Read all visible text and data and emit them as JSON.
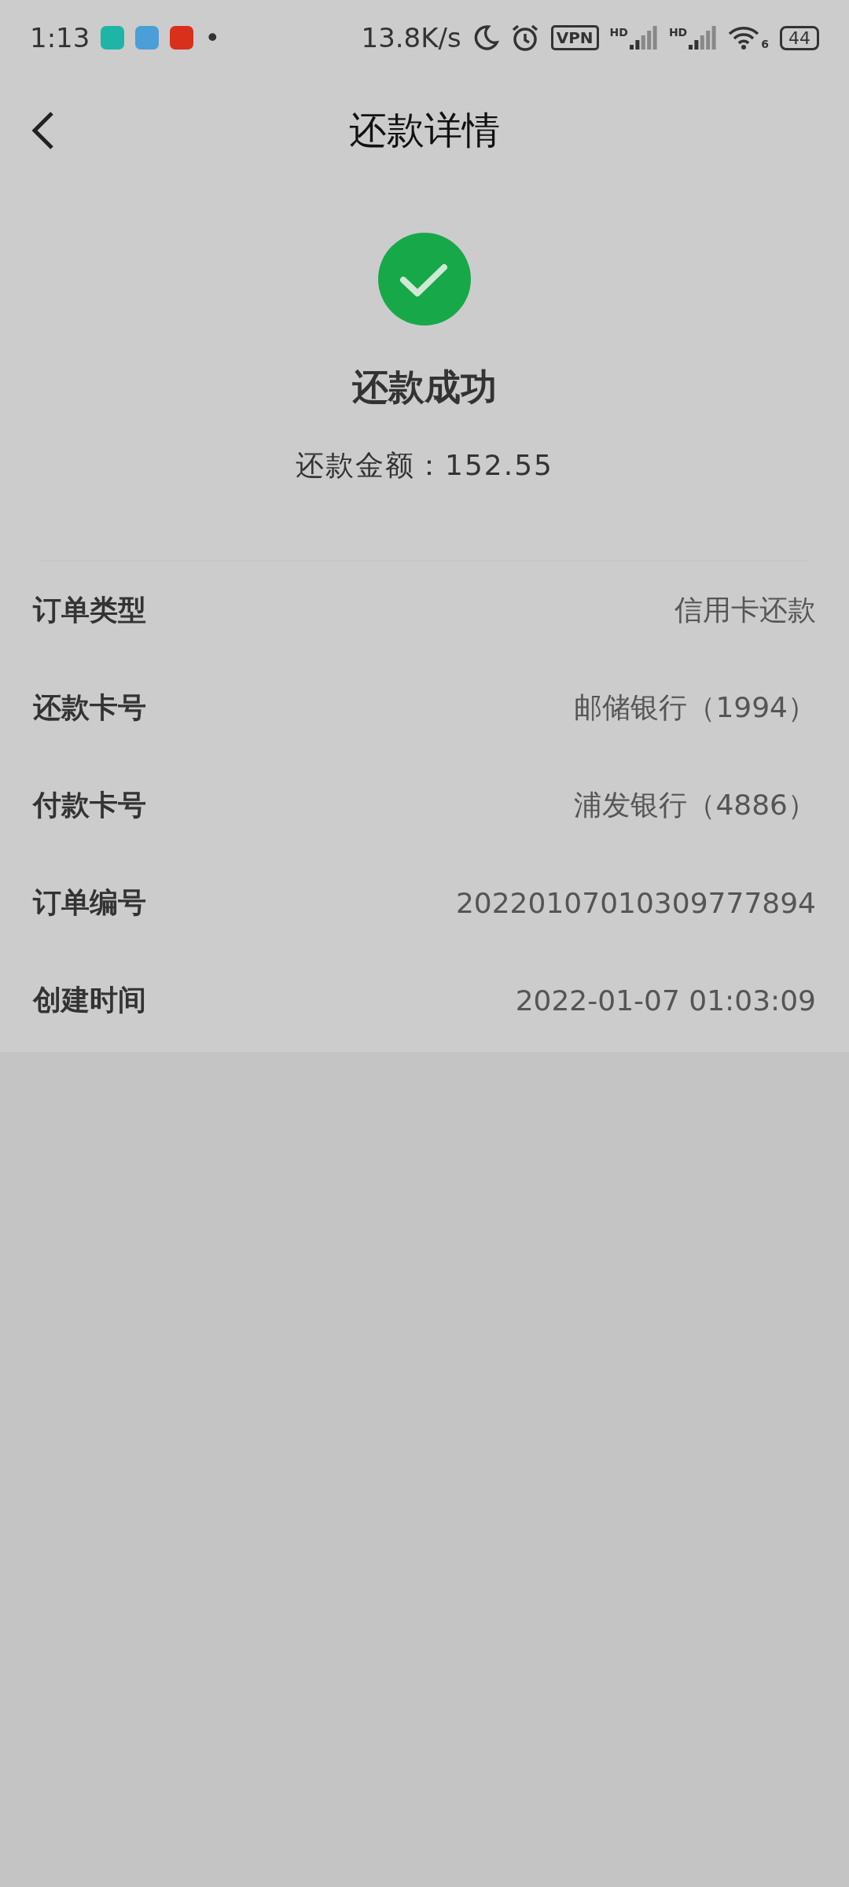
{
  "status_bar": {
    "time": "1:13",
    "app_icons": [
      {
        "color": "#1fb5a6"
      },
      {
        "color": "#4a9fd8"
      },
      {
        "color": "#d9301c"
      }
    ],
    "dot": "•",
    "speed": "13.8K/s",
    "vpn": "VPN",
    "signals": [
      {
        "label": "HD"
      },
      {
        "label": "HD"
      }
    ],
    "wifi_label": "6",
    "battery": "44"
  },
  "header": {
    "title": "还款详情"
  },
  "result": {
    "title": "还款成功",
    "amount_label": "还款金额：",
    "amount": "152.55"
  },
  "details": [
    {
      "label": "订单类型",
      "value": "信用卡还款"
    },
    {
      "label": "还款卡号",
      "value": "邮储银行（1994）"
    },
    {
      "label": "付款卡号",
      "value": "浦发银行（4886）"
    },
    {
      "label": "订单编号",
      "value": "20220107010309777894"
    },
    {
      "label": "创建时间",
      "value": "2022-01-07 01:03:09"
    }
  ]
}
